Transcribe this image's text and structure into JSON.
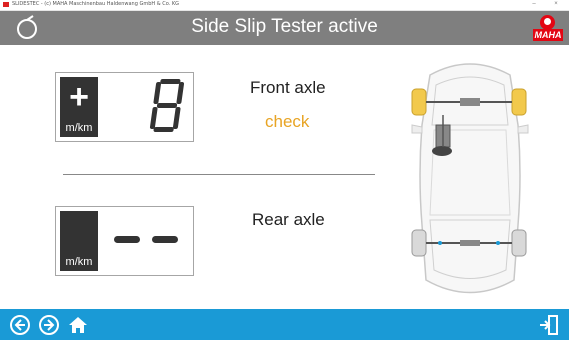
{
  "window": {
    "title": "SLIDESTEC - (c) MAHA Maschinenbau Haldenwang GmbH & Co. KG",
    "minimize": "–",
    "close": "×"
  },
  "header": {
    "title": "Side Slip Tester active",
    "brand": "MAHA"
  },
  "front": {
    "label": "Front axle",
    "status": "check",
    "sign": "+",
    "unit": "m/km",
    "value": "8"
  },
  "rear": {
    "label": "Rear axle",
    "sign": "",
    "unit": "m/km",
    "value": "- -"
  },
  "icons": {
    "back": "arrow-left-circle-icon",
    "forward": "arrow-right-circle-icon",
    "home": "home-icon",
    "exit": "exit-door-icon"
  },
  "colors": {
    "header": "#7f7f7f",
    "bottom_bar": "#1a9ad6",
    "status": "#e8a424",
    "display_dark": "#333333",
    "brand_red": "#e30613",
    "wheel_highlight": "#f2c94c"
  }
}
